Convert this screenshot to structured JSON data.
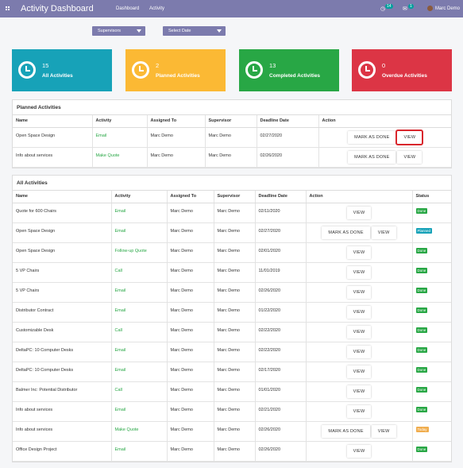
{
  "app": {
    "title": "Activity Dashboard"
  },
  "nav": {
    "dashboard": "Dashboard",
    "activity": "Activity"
  },
  "systray": {
    "activity_count": "14",
    "message_count": "1",
    "user": "Marc Demo"
  },
  "filters": {
    "supervisors": "Supervisors",
    "date": "Select Date"
  },
  "cards": [
    {
      "count": "15",
      "label": "All Activities",
      "color": "#17a2b8"
    },
    {
      "count": "2",
      "label": "Planned Activities",
      "color": "#fbb934"
    },
    {
      "count": "13",
      "label": "Completed Activities",
      "color": "#28a745"
    },
    {
      "count": "0",
      "label": "Overdue Activities",
      "color": "#dc3545"
    }
  ],
  "planned": {
    "title": "Planned Activities",
    "headers": [
      "Name",
      "Activity",
      "Assigned To",
      "Supervisor",
      "Deadline Date",
      "Action"
    ],
    "rows": [
      {
        "name": "Open Space Design",
        "activity": "Email",
        "assigned": "Marc Demo",
        "supervisor": "Marc Demo",
        "deadline": "02/27/2020"
      },
      {
        "name": "Info about services",
        "activity": "Make Quote",
        "assigned": "Marc Demo",
        "supervisor": "Marc Demo",
        "deadline": "02/26/2020"
      }
    ]
  },
  "all": {
    "title": "All Activities",
    "headers": [
      "Name",
      "Activity",
      "Assigned To",
      "Supervisor",
      "Deadline Date",
      "Action",
      "Status"
    ],
    "rows": [
      {
        "name": "Quote for 600 Chairs",
        "activity": "Email",
        "assigned": "Marc Demo",
        "supervisor": "Marc Demo",
        "deadline": "02/11/2020",
        "status": "Done"
      },
      {
        "name": "Open Space Design",
        "activity": "Email",
        "assigned": "Marc Demo",
        "supervisor": "Marc Demo",
        "deadline": "02/27/2020",
        "status": "Planned"
      },
      {
        "name": "Open Space Design",
        "activity": "Follow-up Quote",
        "assigned": "Marc Demo",
        "supervisor": "Marc Demo",
        "deadline": "02/01/2020",
        "status": "Done"
      },
      {
        "name": "5 VP Chairs",
        "activity": "Call",
        "assigned": "Marc Demo",
        "supervisor": "Marc Demo",
        "deadline": "11/01/2019",
        "status": "Done"
      },
      {
        "name": "5 VP Chairs",
        "activity": "Email",
        "assigned": "Marc Demo",
        "supervisor": "Marc Demo",
        "deadline": "02/26/2020",
        "status": "Done"
      },
      {
        "name": "Distributor Contract",
        "activity": "Email",
        "assigned": "Marc Demo",
        "supervisor": "Marc Demo",
        "deadline": "01/22/2020",
        "status": "Done"
      },
      {
        "name": "Customizable Desk",
        "activity": "Call",
        "assigned": "Marc Demo",
        "supervisor": "Marc Demo",
        "deadline": "02/22/2020",
        "status": "Done"
      },
      {
        "name": "DeltaPC: 10 Computer Desks",
        "activity": "Email",
        "assigned": "Marc Demo",
        "supervisor": "Marc Demo",
        "deadline": "02/22/2020",
        "status": "Done"
      },
      {
        "name": "DeltaPC: 10 Computer Desks",
        "activity": "Email",
        "assigned": "Marc Demo",
        "supervisor": "Marc Demo",
        "deadline": "02/17/2020",
        "status": "Done"
      },
      {
        "name": "Balmer Inc: Potential Distributor",
        "activity": "Call",
        "assigned": "Marc Demo",
        "supervisor": "Marc Demo",
        "deadline": "01/01/2020",
        "status": "Done"
      },
      {
        "name": "Info about services",
        "activity": "Email",
        "assigned": "Marc Demo",
        "supervisor": "Marc Demo",
        "deadline": "02/21/2020",
        "status": "Done"
      },
      {
        "name": "Info about services",
        "activity": "Make Quote",
        "assigned": "Marc Demo",
        "supervisor": "Marc Demo",
        "deadline": "02/26/2020",
        "status": "Today"
      },
      {
        "name": "Office Design Project",
        "activity": "Email",
        "assigned": "Marc Demo",
        "supervisor": "Marc Demo",
        "deadline": "02/26/2020",
        "status": "Done"
      }
    ]
  },
  "labels": {
    "mark_done": "MARK AS DONE",
    "view": "VIEW"
  },
  "status_colors": {
    "Done": "#28a745",
    "Planned": "#17a2b8",
    "Today": "#f0ad4e"
  }
}
